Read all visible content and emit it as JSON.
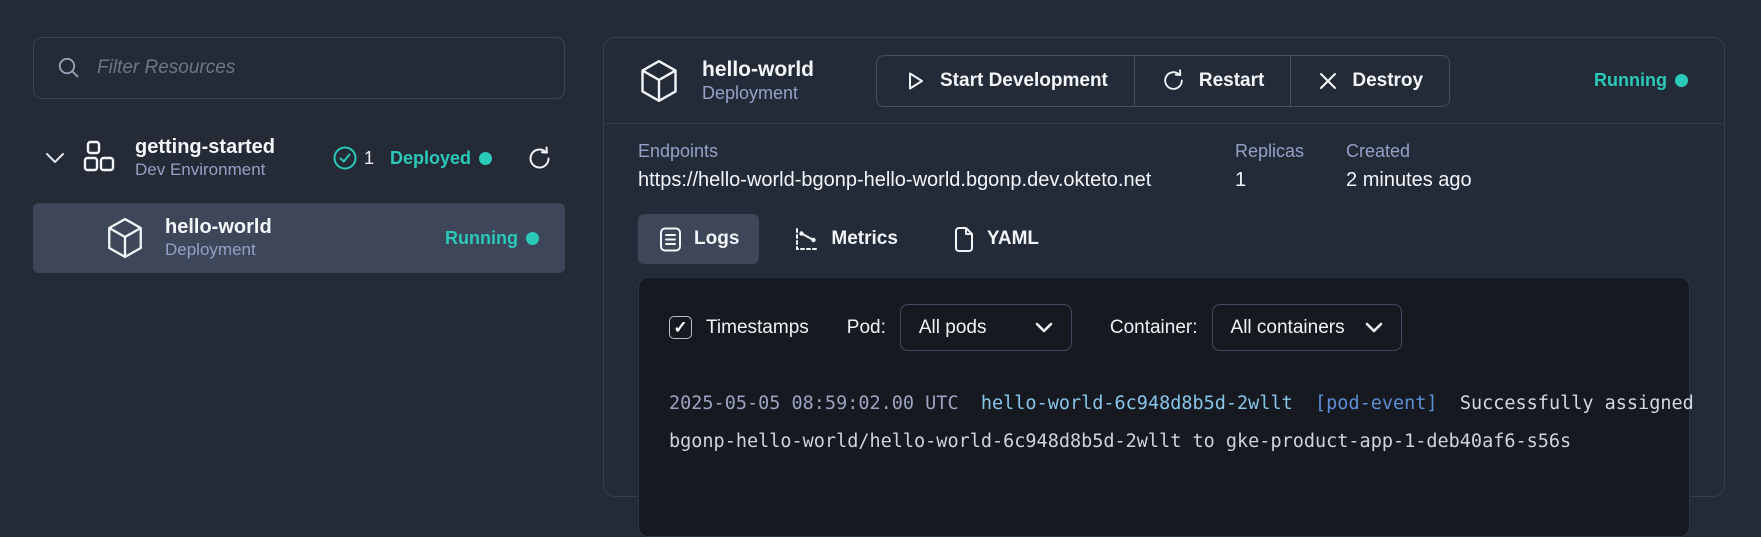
{
  "colors": {
    "accent": "#2bc9ba",
    "panel_bg": "#16191f",
    "selected_bg": "#3d4759"
  },
  "sidebar": {
    "filter_placeholder": "Filter Resources",
    "environment": {
      "name": "getting-started",
      "type": "Dev Environment",
      "count": "1",
      "status": "Deployed"
    },
    "resource": {
      "name": "hello-world",
      "type": "Deployment",
      "status": "Running"
    }
  },
  "detail": {
    "title": "hello-world",
    "subtitle": "Deployment",
    "status": "Running",
    "actions": [
      {
        "label": "Start Development",
        "icon": "play-icon"
      },
      {
        "label": "Restart",
        "icon": "refresh-icon"
      },
      {
        "label": "Destroy",
        "icon": "close-icon"
      }
    ],
    "info": {
      "endpoints_label": "Endpoints",
      "endpoint_url": "https://hello-world-bgonp-hello-world.bgonp.dev.okteto.net",
      "replicas_label": "Replicas",
      "replicas_value": "1",
      "created_label": "Created",
      "created_value": "2 minutes ago"
    },
    "tabs": [
      {
        "label": "Logs",
        "icon": "logs-icon",
        "active": true
      },
      {
        "label": "Metrics",
        "icon": "metrics-icon",
        "active": false
      },
      {
        "label": "YAML",
        "icon": "yaml-icon",
        "active": false
      }
    ],
    "logs": {
      "timestamps_label": "Timestamps",
      "pod_label": "Pod:",
      "pod_value": "All pods",
      "container_label": "Container:",
      "container_value": "All containers",
      "entries": [
        {
          "timestamp": "2025-05-05 08:59:02.00 UTC",
          "pod": "hello-world-6c948d8b5d-2wllt",
          "tag": "[pod-event]",
          "message": "Successfully assigned",
          "continuation": "bgonp-hello-world/hello-world-6c948d8b5d-2wllt to gke-product-app-1-deb40af6-s56s"
        }
      ]
    }
  }
}
